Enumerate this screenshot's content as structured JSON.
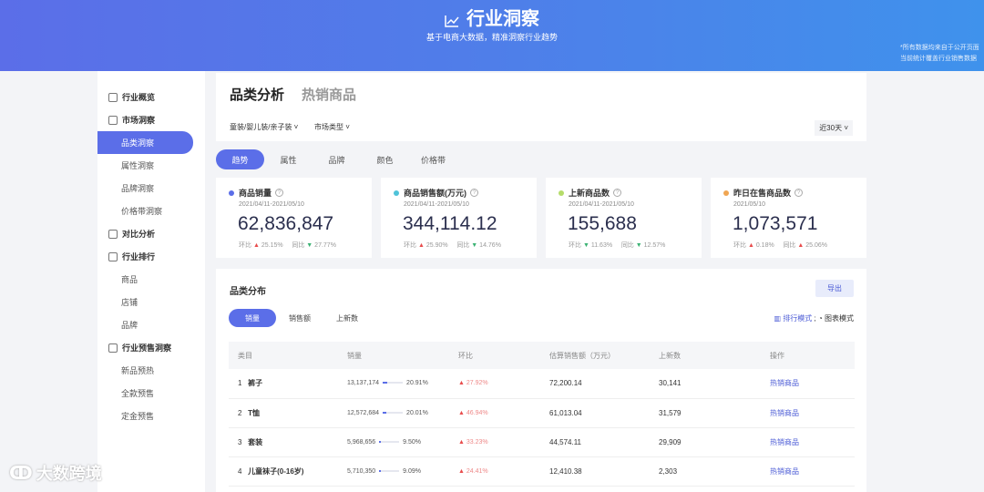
{
  "header": {
    "title": "行业洞察",
    "subtitle": "基于电商大数据，精准洞察行业趋势",
    "note_line1": "*所有数据均来自于公开页面",
    "note_line2": "当前统计覆盖行业销售数据"
  },
  "sidebar": {
    "items": [
      {
        "label": "行业概览",
        "type": "group"
      },
      {
        "label": "市场洞察",
        "type": "group"
      },
      {
        "label": "品类洞察",
        "type": "sub",
        "active": true
      },
      {
        "label": "属性洞察",
        "type": "sub"
      },
      {
        "label": "品牌洞察",
        "type": "sub"
      },
      {
        "label": "价格带洞察",
        "type": "sub"
      },
      {
        "label": "对比分析",
        "type": "group"
      },
      {
        "label": "行业排行",
        "type": "group"
      },
      {
        "label": "商品",
        "type": "sub"
      },
      {
        "label": "店铺",
        "type": "sub"
      },
      {
        "label": "品牌",
        "type": "sub"
      },
      {
        "label": "行业预售洞察",
        "type": "group"
      },
      {
        "label": "新品预热",
        "type": "sub"
      },
      {
        "label": "全款预售",
        "type": "sub"
      },
      {
        "label": "定金预售",
        "type": "sub"
      }
    ]
  },
  "top": {
    "tab1": "品类分析",
    "tab2": "热销商品",
    "filter1": "童装/婴儿装/亲子装",
    "filter2": "市场类型",
    "range": "近30天"
  },
  "tabs": [
    "趋势",
    "属性",
    "品牌",
    "颜色",
    "价格带"
  ],
  "metrics": [
    {
      "label": "商品销量",
      "color": "#5b6ee8",
      "date": "2021/04/11-2021/05/10",
      "value": "62,836,847",
      "hb": "25.15%",
      "hb_dir": "up",
      "tb": "27.77%",
      "tb_dir": "down"
    },
    {
      "label": "商品销售额(万元)",
      "color": "#4fc3d9",
      "date": "2021/04/11-2021/05/10",
      "value": "344,114.12",
      "hb": "25.90%",
      "hb_dir": "up",
      "tb": "14.76%",
      "tb_dir": "down"
    },
    {
      "label": "上新商品数",
      "color": "#b5dc6a",
      "date": "2021/04/11-2021/05/10",
      "value": "155,688",
      "hb": "11.63%",
      "hb_dir": "down",
      "tb": "12.57%",
      "tb_dir": "down"
    },
    {
      "label": "昨日在售商品数",
      "color": "#f0a653",
      "date": "2021/05/10",
      "value": "1,073,571",
      "hb": "0.18%",
      "hb_dir": "up",
      "tb": "25.06%",
      "tb_dir": "up"
    }
  ],
  "cmp_labels": {
    "hb": "环比",
    "tb": "同比"
  },
  "dist": {
    "title": "品类分布",
    "export": "导出",
    "tabs": [
      "销量",
      "销售额",
      "上新数"
    ],
    "mode1": "排行模式",
    "mode2": "图表模式",
    "columns": [
      "类目",
      "销量",
      "环比",
      "估算销售额（万元）",
      "上新数",
      "操作"
    ],
    "rows": [
      {
        "rank": "1",
        "name": "裤子",
        "sales": "13,137,174",
        "share": "20.91%",
        "share_val": 20.91,
        "hb": "27.92%",
        "amount": "72,200.14",
        "new": "30,141",
        "action": "热销商品"
      },
      {
        "rank": "2",
        "name": "T恤",
        "sales": "12,572,684",
        "share": "20.01%",
        "share_val": 20.01,
        "hb": "46.94%",
        "amount": "61,013.04",
        "new": "31,579",
        "action": "热销商品"
      },
      {
        "rank": "3",
        "name": "套装",
        "sales": "5,968,656",
        "share": "9.50%",
        "share_val": 9.5,
        "hb": "33.23%",
        "amount": "44,574.11",
        "new": "29,909",
        "action": "热销商品"
      },
      {
        "rank": "4",
        "name": "儿童袜子(0-16岁)",
        "sales": "5,710,350",
        "share": "9.09%",
        "share_val": 9.09,
        "hb": "24.41%",
        "amount": "12,410.38",
        "new": "2,303",
        "action": "热销商品"
      }
    ]
  },
  "watermark": "大数跨境"
}
